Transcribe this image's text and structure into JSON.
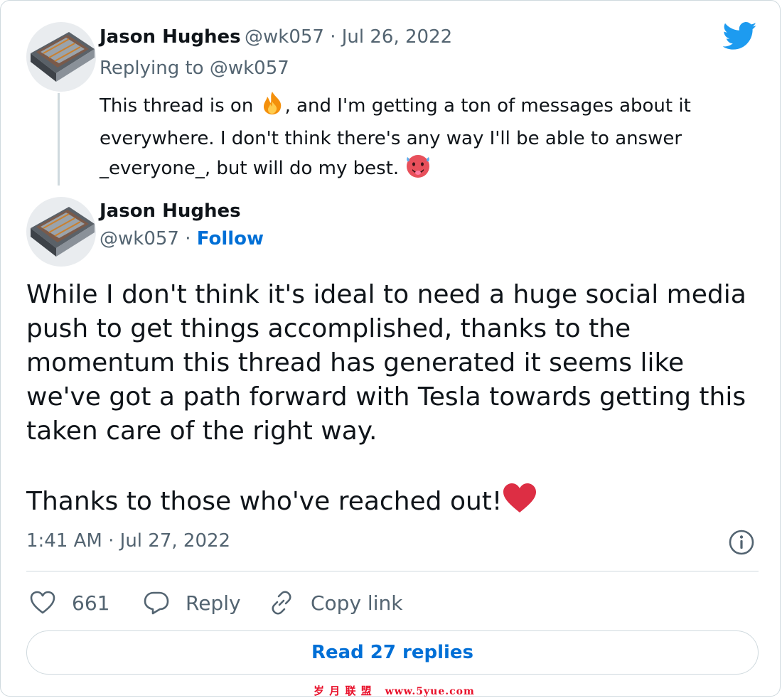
{
  "reply_tweet": {
    "author_name": "Jason Hughes",
    "meta": "@wk057 · Jul 26, 2022",
    "replying_to": "Replying to @wk057",
    "text_part1": "This thread is on ",
    "text_part2": ", and I'm getting a ton of messages about it everywhere. I don't think there's any way I'll be able to answer _everyone_, but will do my best. ",
    "emoji_fire": "fire-emoji",
    "emoji_hot_face": "hot-face-emoji"
  },
  "main_tweet": {
    "author_name": "Jason Hughes",
    "handle": "@wk057",
    "separator": " · ",
    "follow_label": "Follow",
    "paragraph1": "While I don't think it's ideal to need a huge social media push to get things accomplished, thanks to the momentum this thread has generated it seems like we've got a path forward with Tesla towards getting this taken care of the right way.",
    "paragraph2": "Thanks to those who've reached out!",
    "emoji_heart": "red-heart-emoji",
    "timestamp": "1:41 AM · Jul 27, 2022"
  },
  "actions": {
    "like_count": "661",
    "reply_label": "Reply",
    "copy_link_label": "Copy link"
  },
  "read_replies_label": "Read 27 replies",
  "watermark": {
    "cn": "岁 月 联 盟",
    "url": "www.5yue.com"
  },
  "colors": {
    "twitter_blue": "#1d9bf0",
    "link_blue": "#006fd6",
    "muted": "#536471",
    "heart_red": "#e0245e"
  },
  "icons": [
    "twitter-bird-icon",
    "info-icon",
    "heart-icon",
    "reply-bubble-icon",
    "link-icon"
  ]
}
